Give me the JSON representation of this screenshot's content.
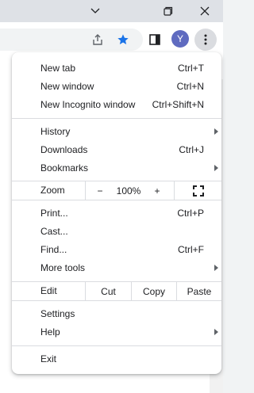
{
  "toolbar": {
    "avatar_letter": "Y"
  },
  "menu": {
    "group1": [
      {
        "label": "New tab",
        "shortcut": "Ctrl+T"
      },
      {
        "label": "New window",
        "shortcut": "Ctrl+N"
      },
      {
        "label": "New Incognito window",
        "shortcut": "Ctrl+Shift+N"
      }
    ],
    "group2": [
      {
        "label": "History",
        "shortcut": ""
      },
      {
        "label": "Downloads",
        "shortcut": "Ctrl+J"
      },
      {
        "label": "Bookmarks",
        "shortcut": ""
      }
    ],
    "zoom": {
      "label": "Zoom",
      "minus": "−",
      "value": "100%",
      "plus": "+"
    },
    "group3": [
      {
        "label": "Print...",
        "shortcut": "Ctrl+P"
      },
      {
        "label": "Cast...",
        "shortcut": ""
      },
      {
        "label": "Find...",
        "shortcut": "Ctrl+F"
      },
      {
        "label": "More tools",
        "shortcut": ""
      }
    ],
    "edit": {
      "label": "Edit",
      "cut": "Cut",
      "copy": "Copy",
      "paste": "Paste"
    },
    "group4": [
      {
        "label": "Settings",
        "shortcut": ""
      },
      {
        "label": "Help",
        "shortcut": ""
      }
    ],
    "exit": {
      "label": "Exit"
    }
  },
  "colors": {
    "accent_star": "#1a73e8",
    "avatar_bg": "#5f6bc0"
  }
}
